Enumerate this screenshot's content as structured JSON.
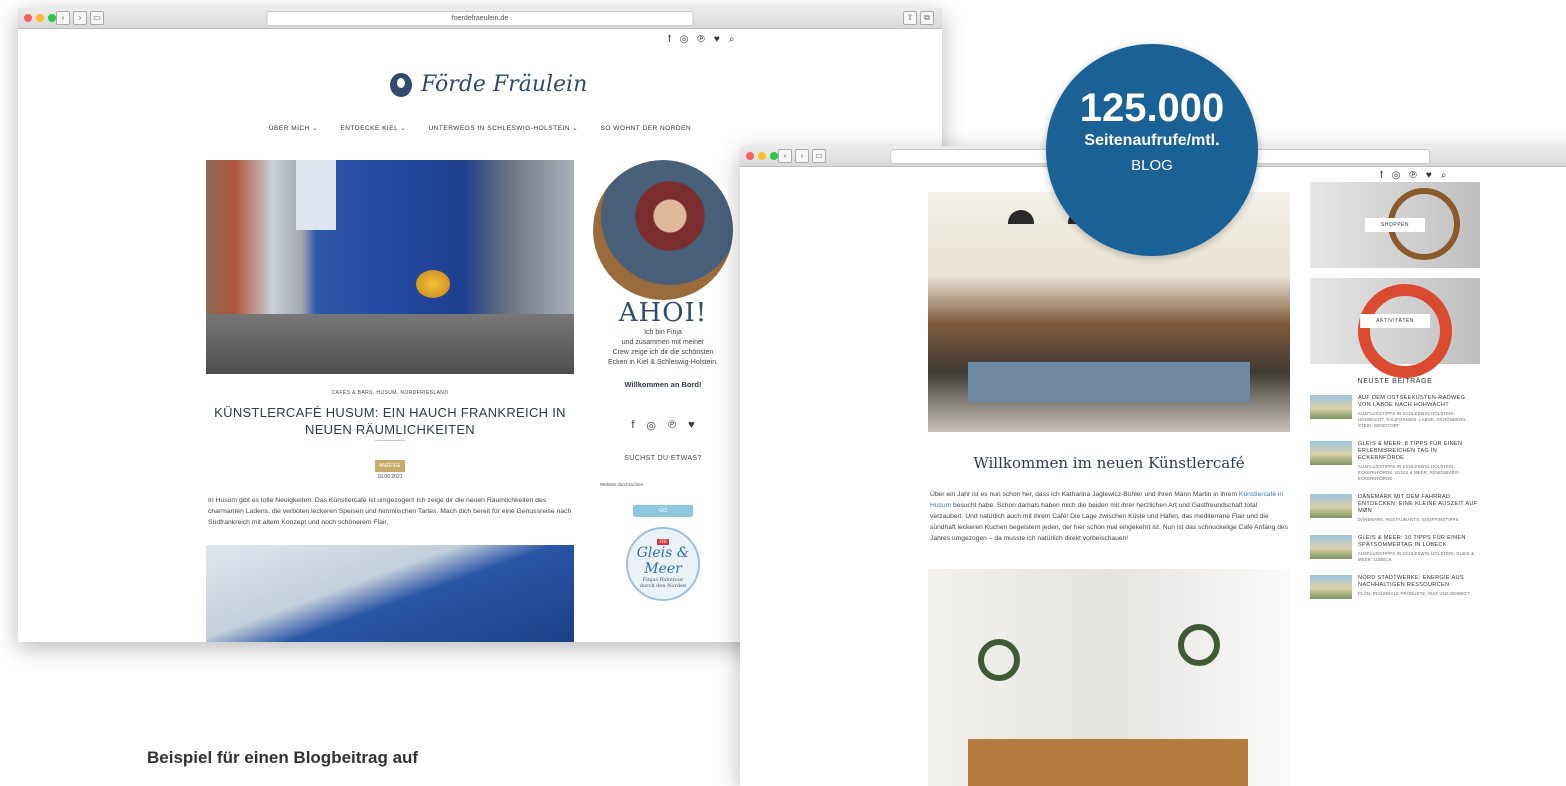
{
  "window1": {
    "url": "foerdefraeulein.de",
    "social_icons": [
      "f",
      "◎",
      "℗",
      "♥",
      "⌕"
    ],
    "logo_text": "Förde Fräulein",
    "menu": [
      "ÜBER MICH ⌄",
      "ENTDECKE KIEL ⌄",
      "UNTERWEGS IN SCHLESWIG-HOLSTEIN ⌄",
      "SO WOHNT DER NORDEN"
    ],
    "post": {
      "categories": "CAFÉS & BARS, HUSUM, NORDFRIESLAND",
      "title": "KÜNSTLERCAFÉ HUSUM: EIN HAUCH FRANKREICH IN NEUEN RÄUMLICHKEITEN",
      "tag": "ANZEIGE",
      "date": "16.06.2021",
      "excerpt": "In Husum gibt es tolle Neuigkeiten: Das Künstlercafé ist umgezogen! Ich zeige dir die neuen Räumlichkeiten des charmanten Ladens, die verboten leckeren Speisen und himmlischen Tartes. Mach dich bereit für eine Genussreise nach Südfrankreich mit altem Konzept und noch schönerem Flair."
    },
    "sidebar": {
      "ahoi": "AHOI!",
      "intro_1": "Ich bin Finja",
      "intro_2": "und zusammen mit meiner",
      "intro_3": "Crew zeige ich dir die schönsten",
      "intro_4": "Ecken in Kiel & Schleswig-Holstein.",
      "welcome": "Willkommen an Bord!",
      "social_icons": [
        "f",
        "◎",
        "℗",
        "♥"
      ],
      "search_title": "SUCHST DU ETWAS?",
      "search_placeholder": "Website durchsuchen",
      "search_button": "GO",
      "gleis_badge": "DB",
      "gleis_title_1": "Gleis &",
      "gleis_title_2": "Meer",
      "gleis_sub_1": "Finjas Bahntour",
      "gleis_sub_2": "durch den Norden"
    }
  },
  "badge": {
    "number": "125.000",
    "label": "Seitenaufrufe/mtl.",
    "sub": "BLOG"
  },
  "window2": {
    "social_icons": [
      "f",
      "◎",
      "℗",
      "♥",
      "⌕"
    ],
    "title": "Willkommen im neuen Künstlercafé",
    "text_1": "Über ein Jahr ist es nun schon her, dass ich Katharina Jaglewicz-Bühler und ihren Mann Martin in ihrem ",
    "text_link": "Künstlercafé in Husum",
    "text_2": " besucht habe. Schon damals haben mich die beiden mit ihrer herzlichen Art und Gastfreundschaft total verzaubert. Und natürlich auch mit ihrem Café! Die Lage zwischen Küste und Hafen, das mediterrane Flair und die sündhaft leckeren Kuchen begeistern jeden, der hier schon mal eingekehrt ist. Nun ist das schnuckelige Café Anfang des Jahres umgezogen – da musste ich natürlich direkt vorbeischauen!",
    "tiles": [
      {
        "button": "SHOPPEN"
      },
      {
        "button": "AKTIVITÄTEN"
      }
    ],
    "latest_title": "NEUSTE BEITRÄGE",
    "posts": [
      {
        "title": "AUF DEM OSTSEEKÜSTEN-RADWEG VON LABOE NACH HOHWACHT",
        "cats": "AUSFLUGSTIPPS IN SCHLESWIG-HOLSTEIN, HOHWACHT, KALIFORNIEN, LABOE, SCHÖNBERG, STEIN, WENDTORF"
      },
      {
        "title": "GLEIS & MEER: 8 TIPPS FÜR EINEN ERLEBNISREICHEN TAG IN ECKERNFÖRDE",
        "cats": "AUSFLUGSTIPPS IN SCHLESWIG-HOLSTEIN, ECKERNFÖRDE, GLEIS & MEER, RENDSBURG-ECKERNFÖRDE"
      },
      {
        "title": "DÄNEMARK MIT DEM FAHRRAD ENTDECKEN: EINE KLEINE AUSZEIT AUF MØN",
        "cats": "DÄNEMARK, RESTAURANTS, SHOPPINGTIPPS"
      },
      {
        "title": "GLEIS & MEER: 10 TIPPS FÜR EINEN SPÄTSOMMERTAG IN LÜBECK",
        "cats": "AUSFLUGSTIPPS IN SCHLESWIG-HOLSTEIN, GLEIS & MEER, LÜBECK"
      },
      {
        "title": "NORD STADTWERKE: ENERGIE AUS NACHHALTIGEN RESSOURCEN",
        "cats": "PLÖN, REGIONALE PRODUKTE, WAS UNS BEWEGT"
      }
    ]
  },
  "caption": "Beispiel für einen Blogbeitrag auf",
  "colors": {
    "accent": "#1a6196",
    "logo": "#2f4b6e",
    "tag": "#c8a96a"
  }
}
